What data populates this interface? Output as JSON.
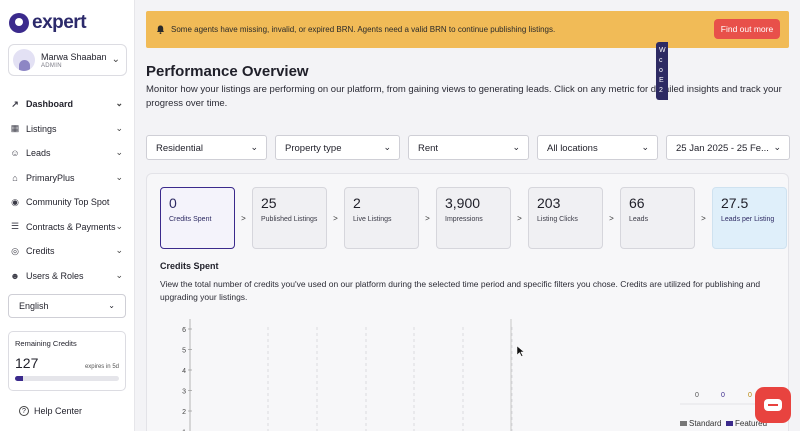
{
  "brand": {
    "name": "expert"
  },
  "user": {
    "name": "Marwa Shaaban",
    "role": "ADMIN"
  },
  "nav": {
    "items": [
      {
        "label": "Dashboard",
        "icon": "chart-line-icon",
        "has_chevron": true,
        "active": true
      },
      {
        "label": "Listings",
        "icon": "building-icon",
        "has_chevron": true
      },
      {
        "label": "Leads",
        "icon": "person-icon",
        "has_chevron": true
      },
      {
        "label": "PrimaryPlus",
        "icon": "store-icon",
        "has_chevron": true
      },
      {
        "label": "Community Top Spot",
        "icon": "location-pin-icon",
        "has_chevron": false
      },
      {
        "label": "Contracts & Payments",
        "icon": "document-icon",
        "has_chevron": true
      },
      {
        "label": "Credits",
        "icon": "coins-icon",
        "has_chevron": true
      },
      {
        "label": "Users & Roles",
        "icon": "users-icon",
        "has_chevron": true
      }
    ]
  },
  "language": {
    "selected": "English"
  },
  "credits": {
    "title": "Remaining Credits",
    "amount": "127",
    "expires": "expires in 5d",
    "progress": 0.08
  },
  "help": {
    "label": "Help Center"
  },
  "banner": {
    "message": "Some agents have missing, invalid, or expired BRN. Agents need a valid BRN to continue publishing listings.",
    "button": "Find out more"
  },
  "side_tab": {
    "lines": [
      "W",
      "c",
      "o",
      "E",
      "2"
    ]
  },
  "page": {
    "title": "Performance Overview",
    "description": "Monitor how your listings are performing on our platform, from gaining views to generating leads. Click on any metric for detailed insights and track your progress over time."
  },
  "filters": {
    "category": "Residential",
    "property_type": "Property type",
    "offering": "Rent",
    "location": "All locations",
    "date_range": "25 Jan 2025 - 25 Fe..."
  },
  "metrics": [
    {
      "value": "0",
      "label": "Credits Spent"
    },
    {
      "value": "25",
      "label": "Published Listings"
    },
    {
      "value": "2",
      "label": "Live Listings"
    },
    {
      "value": "3,900",
      "label": "Impressions"
    },
    {
      "value": "203",
      "label": "Listing Clicks"
    },
    {
      "value": "66",
      "label": "Leads"
    },
    {
      "value": "27.5",
      "label": "Leads per Listing"
    }
  ],
  "metric_separator": ">",
  "section": {
    "title": "Credits Spent",
    "description": "View the total number of credits you've used on our platform during the selected time period and specific filters you chose. Credits are utilized for publishing and upgrading your listings."
  },
  "chart_data": {
    "type": "bar",
    "yticks": [
      "6",
      "5",
      "4",
      "3",
      "2",
      "1"
    ],
    "ylim": [
      0,
      6
    ],
    "totals": [
      "0",
      "0",
      "0"
    ],
    "total_colors": [
      "#555555",
      "#3b2a8c",
      "#b8860b"
    ],
    "series": [
      {
        "name": "Standard",
        "color": "#777777"
      },
      {
        "name": "Featured",
        "color": "#3b2a8c"
      }
    ]
  },
  "colors": {
    "accent": "#3b2a8c",
    "banner": "#f1bb57",
    "cta": "#e8504a"
  }
}
